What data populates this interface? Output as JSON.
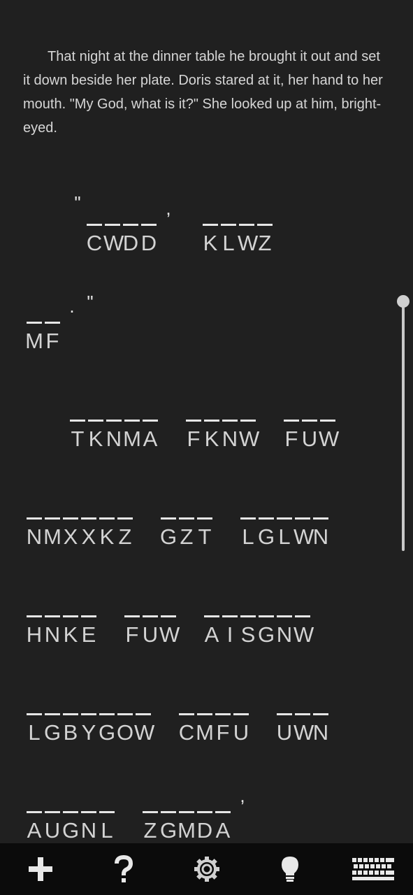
{
  "story": {
    "text": "That night at the dinner table he brought it out and set it down beside her plate. Doris stared at it, her hand to her mouth. \"My God, what is it?\" She looked up at him, bright-eyed."
  },
  "puzzle": {
    "lines": [
      [
        {
          "type": "punct",
          "text": "\""
        },
        {
          "type": "word",
          "letters": [
            "C",
            "W",
            "D",
            "D"
          ]
        },
        {
          "type": "punct",
          "text": ","
        },
        {
          "type": "word",
          "letters": [
            "K",
            "L",
            "W",
            "Z"
          ]
        }
      ],
      [
        {
          "type": "word",
          "letters": [
            "M",
            "F"
          ]
        },
        {
          "type": "punct",
          "text": "."
        },
        {
          "type": "punct",
          "text": "\""
        }
      ],
      [
        {
          "type": "word",
          "letters": [
            "T",
            "K",
            "N",
            "M",
            "A"
          ]
        },
        {
          "type": "word",
          "letters": [
            "F",
            "K",
            "N",
            "W"
          ]
        },
        {
          "type": "word",
          "letters": [
            "F",
            "U",
            "W"
          ]
        }
      ],
      [
        {
          "type": "word",
          "letters": [
            "N",
            "M",
            "X",
            "X",
            "K",
            "Z"
          ]
        },
        {
          "type": "word",
          "letters": [
            "G",
            "Z",
            "T"
          ]
        },
        {
          "type": "word",
          "letters": [
            "L",
            "G",
            "L",
            "W",
            "N"
          ]
        }
      ],
      [
        {
          "type": "word",
          "letters": [
            "H",
            "N",
            "K",
            "E"
          ]
        },
        {
          "type": "word",
          "letters": [
            "F",
            "U",
            "W"
          ]
        },
        {
          "type": "word",
          "letters": [
            "A",
            "I",
            "S",
            "G",
            "N",
            "W"
          ]
        }
      ],
      [
        {
          "type": "word",
          "letters": [
            "L",
            "G",
            "B",
            "Y",
            "G",
            "O",
            "W"
          ]
        },
        {
          "type": "word",
          "letters": [
            "C",
            "M",
            "F",
            "U"
          ]
        },
        {
          "type": "word",
          "letters": [
            "U",
            "W",
            "N"
          ]
        }
      ],
      [
        {
          "type": "word",
          "letters": [
            "A",
            "U",
            "G",
            "N",
            "L"
          ]
        },
        {
          "type": "word",
          "letters": [
            "Z",
            "G",
            "M",
            "D",
            "A"
          ]
        },
        {
          "type": "punct",
          "text": ","
        }
      ]
    ]
  },
  "toolbar": {
    "items": [
      {
        "name": "add-button",
        "icon": "plus-icon"
      },
      {
        "name": "help-button",
        "icon": "question-icon"
      },
      {
        "name": "settings-button",
        "icon": "gear-icon"
      },
      {
        "name": "hint-button",
        "icon": "lightbulb-icon"
      },
      {
        "name": "keyboard-button",
        "icon": "keyboard-icon"
      }
    ]
  },
  "colors": {
    "background": "#202020",
    "toolbar": "#0b0b0b",
    "text": "#d8d8d8"
  }
}
